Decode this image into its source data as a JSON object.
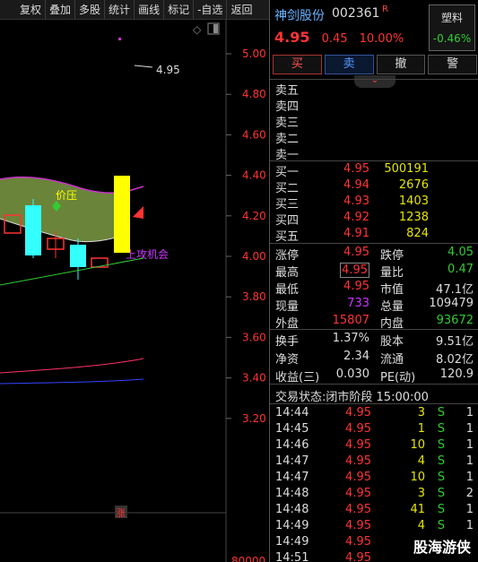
{
  "toolbar": {
    "items": [
      "复权",
      "叠加",
      "多股",
      "统计",
      "画线",
      "标记",
      "-自选",
      "返回"
    ]
  },
  "chart": {
    "y_ticks": [
      "5.00",
      "4.80",
      "4.60",
      "4.40",
      "4.20",
      "4.00",
      "3.80",
      "3.60",
      "3.40",
      "3.20"
    ],
    "volume_tick": "80000",
    "price_callout": "4.95",
    "annot_pressure": "价压",
    "annot_opportunity": "上攻机会",
    "limit_up_marker": "涨",
    "colors": {
      "up_candle": "#ff3333",
      "down_candle": "#33ffff",
      "highlight_candle": "#ffff00",
      "band": "#8fae4f"
    }
  },
  "stock": {
    "name": "神剑股份",
    "code": "002361",
    "flag": "R",
    "price": "4.95",
    "change": "0.45",
    "change_pct": "10.00%",
    "sector": {
      "name": "塑料",
      "change": "-0.46%"
    }
  },
  "actions": {
    "buy": "买",
    "sell": "卖",
    "cancel": "撤",
    "alert": "警"
  },
  "collapse_icon": "⌄",
  "ask": [
    {
      "label": "卖五",
      "price": "",
      "vol": ""
    },
    {
      "label": "卖四",
      "price": "",
      "vol": ""
    },
    {
      "label": "卖三",
      "price": "",
      "vol": ""
    },
    {
      "label": "卖二",
      "price": "",
      "vol": ""
    },
    {
      "label": "卖一",
      "price": "",
      "vol": ""
    }
  ],
  "bid": [
    {
      "label": "买一",
      "price": "4.95",
      "vol": "500191"
    },
    {
      "label": "买二",
      "price": "4.94",
      "vol": "2676"
    },
    {
      "label": "买三",
      "price": "4.93",
      "vol": "1403"
    },
    {
      "label": "买四",
      "price": "4.92",
      "vol": "1238"
    },
    {
      "label": "买五",
      "price": "4.91",
      "vol": "824"
    }
  ],
  "quote": [
    {
      "l1": "涨停",
      "v1": "4.95",
      "c1": "red",
      "l2": "跌停",
      "v2": "4.05",
      "c2": "green"
    },
    {
      "l1": "最高",
      "v1": "4.95",
      "c1": "red",
      "l2": "量比",
      "v2": "0.47",
      "c2": "green",
      "boxed": true
    },
    {
      "l1": "最低",
      "v1": "4.95",
      "c1": "red",
      "l2": "市值",
      "v2": "47.1亿",
      "c2": "white"
    },
    {
      "l1": "现量",
      "v1": "733",
      "c1": "purple",
      "l2": "总量",
      "v2": "109479",
      "c2": "white"
    },
    {
      "l1": "外盘",
      "v1": "15807",
      "c1": "red",
      "l2": "内盘",
      "v2": "93672",
      "c2": "green"
    }
  ],
  "fundamentals": [
    {
      "l1": "换手",
      "v1": "1.37%",
      "l2": "股本",
      "v2": "9.51亿"
    },
    {
      "l1": "净资",
      "v1": "2.34",
      "l2": "流通",
      "v2": "8.02亿"
    },
    {
      "l1": "收益(三)",
      "v1": "0.030",
      "l2": "PE(动)",
      "v2": "120.9"
    }
  ],
  "status": {
    "label": "交易状态:",
    "value": "闭市阶段 15:00:00"
  },
  "ticks": [
    {
      "time": "14:44",
      "price": "4.95",
      "vol": "3",
      "side": "S",
      "n": "1"
    },
    {
      "time": "14:45",
      "price": "4.95",
      "vol": "1",
      "side": "S",
      "n": "1"
    },
    {
      "time": "14:46",
      "price": "4.95",
      "vol": "10",
      "side": "S",
      "n": "1"
    },
    {
      "time": "14:47",
      "price": "4.95",
      "vol": "4",
      "side": "S",
      "n": "1"
    },
    {
      "time": "14:47",
      "price": "4.95",
      "vol": "10",
      "side": "S",
      "n": "1"
    },
    {
      "time": "14:48",
      "price": "4.95",
      "vol": "3",
      "side": "S",
      "n": "2"
    },
    {
      "time": "14:48",
      "price": "4.95",
      "vol": "41",
      "side": "S",
      "n": "1"
    },
    {
      "time": "14:49",
      "price": "4.95",
      "vol": "4",
      "side": "S",
      "n": "1"
    },
    {
      "time": "14:49",
      "price": "4.95",
      "vol": "",
      "side": "",
      "n": ""
    },
    {
      "time": "14:51",
      "price": "4.95",
      "vol": "",
      "side": "",
      "n": ""
    }
  ],
  "watermark": "股海游侠"
}
